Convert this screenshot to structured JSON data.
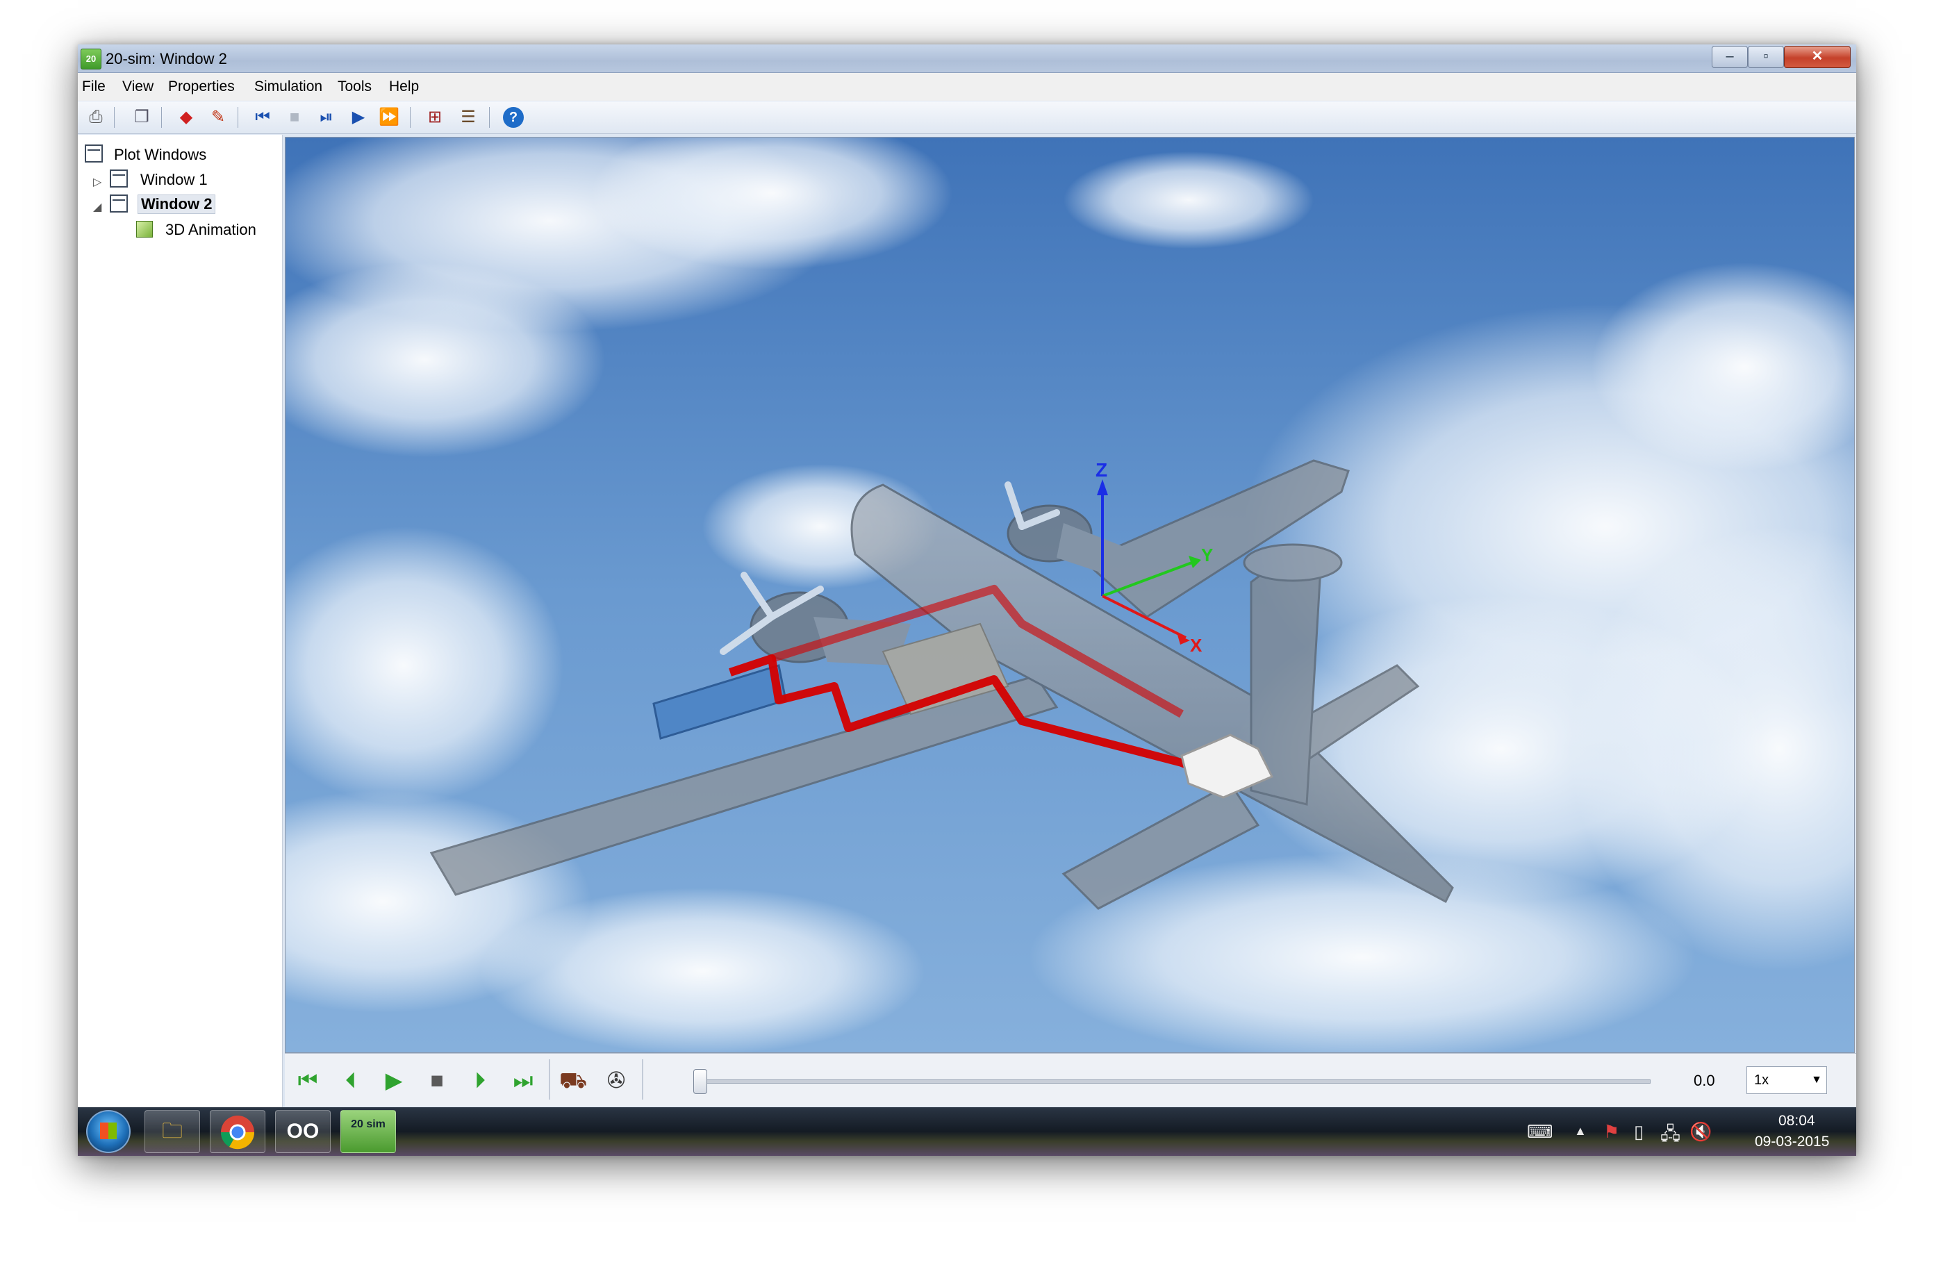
{
  "window": {
    "title": "20-sim: Window 2",
    "app_icon_label": "20"
  },
  "menu": [
    "File",
    "View",
    "Properties",
    "Simulation",
    "Tools",
    "Help"
  ],
  "toolbar_icons": [
    "print-icon",
    "copy-icon",
    "diamond-icon",
    "edit-icon",
    "rewind-icon",
    "stop-icon",
    "step-icon",
    "play-icon",
    "fast-forward-icon",
    "plot-properties-icon",
    "settings-icon",
    "help-icon"
  ],
  "tree": {
    "root": "Plot Windows",
    "items": [
      {
        "label": "Window 1"
      },
      {
        "label": "Window 2",
        "selected": true
      },
      {
        "label": "3D Animation"
      }
    ]
  },
  "scene": {
    "axis_labels": {
      "x": "X",
      "y": "Y",
      "z": "Z"
    },
    "colors": {
      "x": "#e01818",
      "y": "#22c81e",
      "z": "#1a2ee6",
      "fuel_line": "#d40000",
      "fuel_tank": "#4f86c6"
    }
  },
  "playback": {
    "time": "0.0",
    "speed": "1x",
    "slider_fraction": 0
  },
  "taskbar": {
    "apps": [
      "explorer",
      "chrome",
      "app-oo",
      "20-sim"
    ],
    "sim_label": "20 sim",
    "time": "08:04",
    "date": "09-03-2015"
  }
}
